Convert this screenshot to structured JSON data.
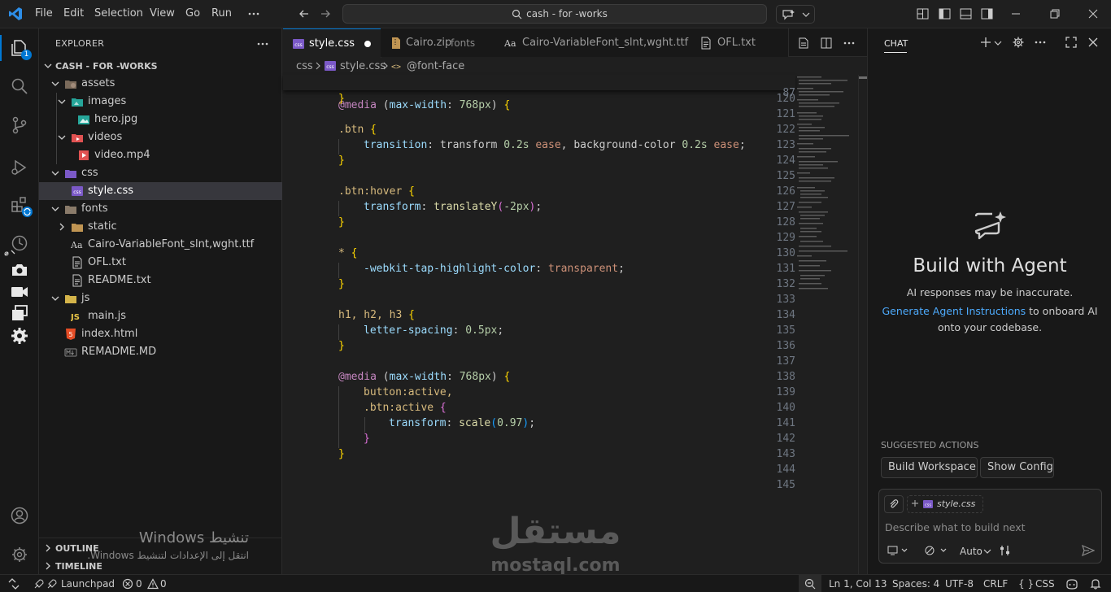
{
  "titlebar": {
    "menu": [
      "File",
      "Edit",
      "Selection",
      "View",
      "Go",
      "Run"
    ],
    "search_text": "cash - for -works"
  },
  "activitybar": {
    "explorer_badge": "1",
    "items": [
      "explorer-icon",
      "search-icon",
      "source-control-icon",
      "run-debug-icon",
      "extensions-icon",
      "timeline-icon",
      "camera-icon",
      "video-icon",
      "windows-icon",
      "settings-icon",
      "account-icon",
      "manage-icon"
    ]
  },
  "sidebar": {
    "title": "EXPLORER",
    "project": "CASH - FOR -WORKS",
    "tree": [
      {
        "label": "assets"
      },
      {
        "label": "images"
      },
      {
        "label": "hero.jpg"
      },
      {
        "label": "videos"
      },
      {
        "label": "video.mp4"
      },
      {
        "label": "css"
      },
      {
        "label": "style.css"
      },
      {
        "label": "fonts"
      },
      {
        "label": "static"
      },
      {
        "label": "Cairo-VariableFont_slnt,wght.ttf"
      },
      {
        "label": "OFL.txt"
      },
      {
        "label": "README.txt"
      },
      {
        "label": "js"
      },
      {
        "label": "main.js"
      },
      {
        "label": "index.html"
      },
      {
        "label": "REMADME.MD"
      }
    ],
    "outline": "OUTLINE",
    "timeline": "TIMELINE"
  },
  "editor": {
    "tabs": [
      {
        "label": "style.css",
        "extra": ""
      },
      {
        "label": "Cairo.zip",
        "extra": "fonts"
      },
      {
        "label": "Cairo-VariableFont_slnt,wght.ttf",
        "extra": ""
      },
      {
        "label": "OFL.txt",
        "extra": ""
      }
    ],
    "breadcrumb": [
      "css",
      "style.css",
      "@font-face"
    ],
    "sticky_line_number": "87",
    "line_numbers": [
      "120",
      "121",
      "122",
      "123",
      "124",
      "125",
      "126",
      "127",
      "128",
      "129",
      "130",
      "131",
      "132",
      "133",
      "134",
      "135",
      "136",
      "137",
      "138",
      "139",
      "140",
      "141",
      "142",
      "143",
      "144",
      "145"
    ],
    "code": {
      "l87": [
        "@media",
        " (",
        "max-width",
        ": ",
        "768px",
        ") ",
        "{"
      ],
      "l120": [
        "}"
      ],
      "l122": [
        ".btn",
        " ",
        "{"
      ],
      "l123": [
        "transition",
        ": ",
        "transform ",
        "0.2s",
        " ",
        "ease",
        ", ",
        "background-color ",
        "0.2s",
        " ",
        "ease",
        ";"
      ],
      "l124": [
        "}"
      ],
      "l126": [
        ".btn:hover",
        " ",
        "{"
      ],
      "l127": [
        "transform",
        ": ",
        "translateY",
        "(",
        "-2px",
        ")",
        ";"
      ],
      "l128": [
        "}"
      ],
      "l130": [
        "*",
        " ",
        "{"
      ],
      "l131": [
        "-webkit-tap-highlight-color",
        ": ",
        "transparent",
        ";"
      ],
      "l132": [
        "}"
      ],
      "l134": [
        "h1, h2, h3",
        " ",
        "{"
      ],
      "l135": [
        "letter-spacing",
        ": ",
        "0.5px",
        ";"
      ],
      "l136": [
        "}"
      ],
      "l138": [
        "@media",
        " (",
        "max-width",
        ": ",
        "768px",
        ") ",
        "{"
      ],
      "l139": [
        "button:active,"
      ],
      "l140": [
        ".btn:active",
        " ",
        "{"
      ],
      "l141": [
        "transform",
        ": ",
        "scale",
        "(",
        "0.97",
        ")",
        ";"
      ],
      "l142": [
        "}"
      ],
      "l143": [
        "}"
      ]
    }
  },
  "chat": {
    "title": "CHAT",
    "heading": "Build with Agent",
    "subtitle": "AI responses may be inaccurate.",
    "link": "Generate Agent Instructions",
    "link_suffix": " to onboard AI",
    "line3": "onto your codebase.",
    "suggested_title": "SUGGESTED ACTIONS",
    "suggested": [
      "Build Workspace",
      "Show Config"
    ],
    "attachment": "style.css",
    "placeholder": "Describe what to build next",
    "mode": "Auto"
  },
  "statusbar": {
    "launchpad": "Launchpad",
    "errors": "0",
    "warnings": "0",
    "position": "Ln 1, Col 13",
    "spaces": "Spaces: 4",
    "encoding": "UTF-8",
    "eol": "CRLF",
    "language": "CSS"
  },
  "watermark": {
    "windows_title": "تنشيط Windows",
    "windows_sub": "انتقل إلى الإعدادات لتنشيط Windows.",
    "logo_ar": "مستقل",
    "logo_en": "mostaql.com"
  },
  "colors": {
    "accent": "#0078d4",
    "background": "#1f1f1f",
    "sidebar": "#181818",
    "link": "#4daafc"
  }
}
